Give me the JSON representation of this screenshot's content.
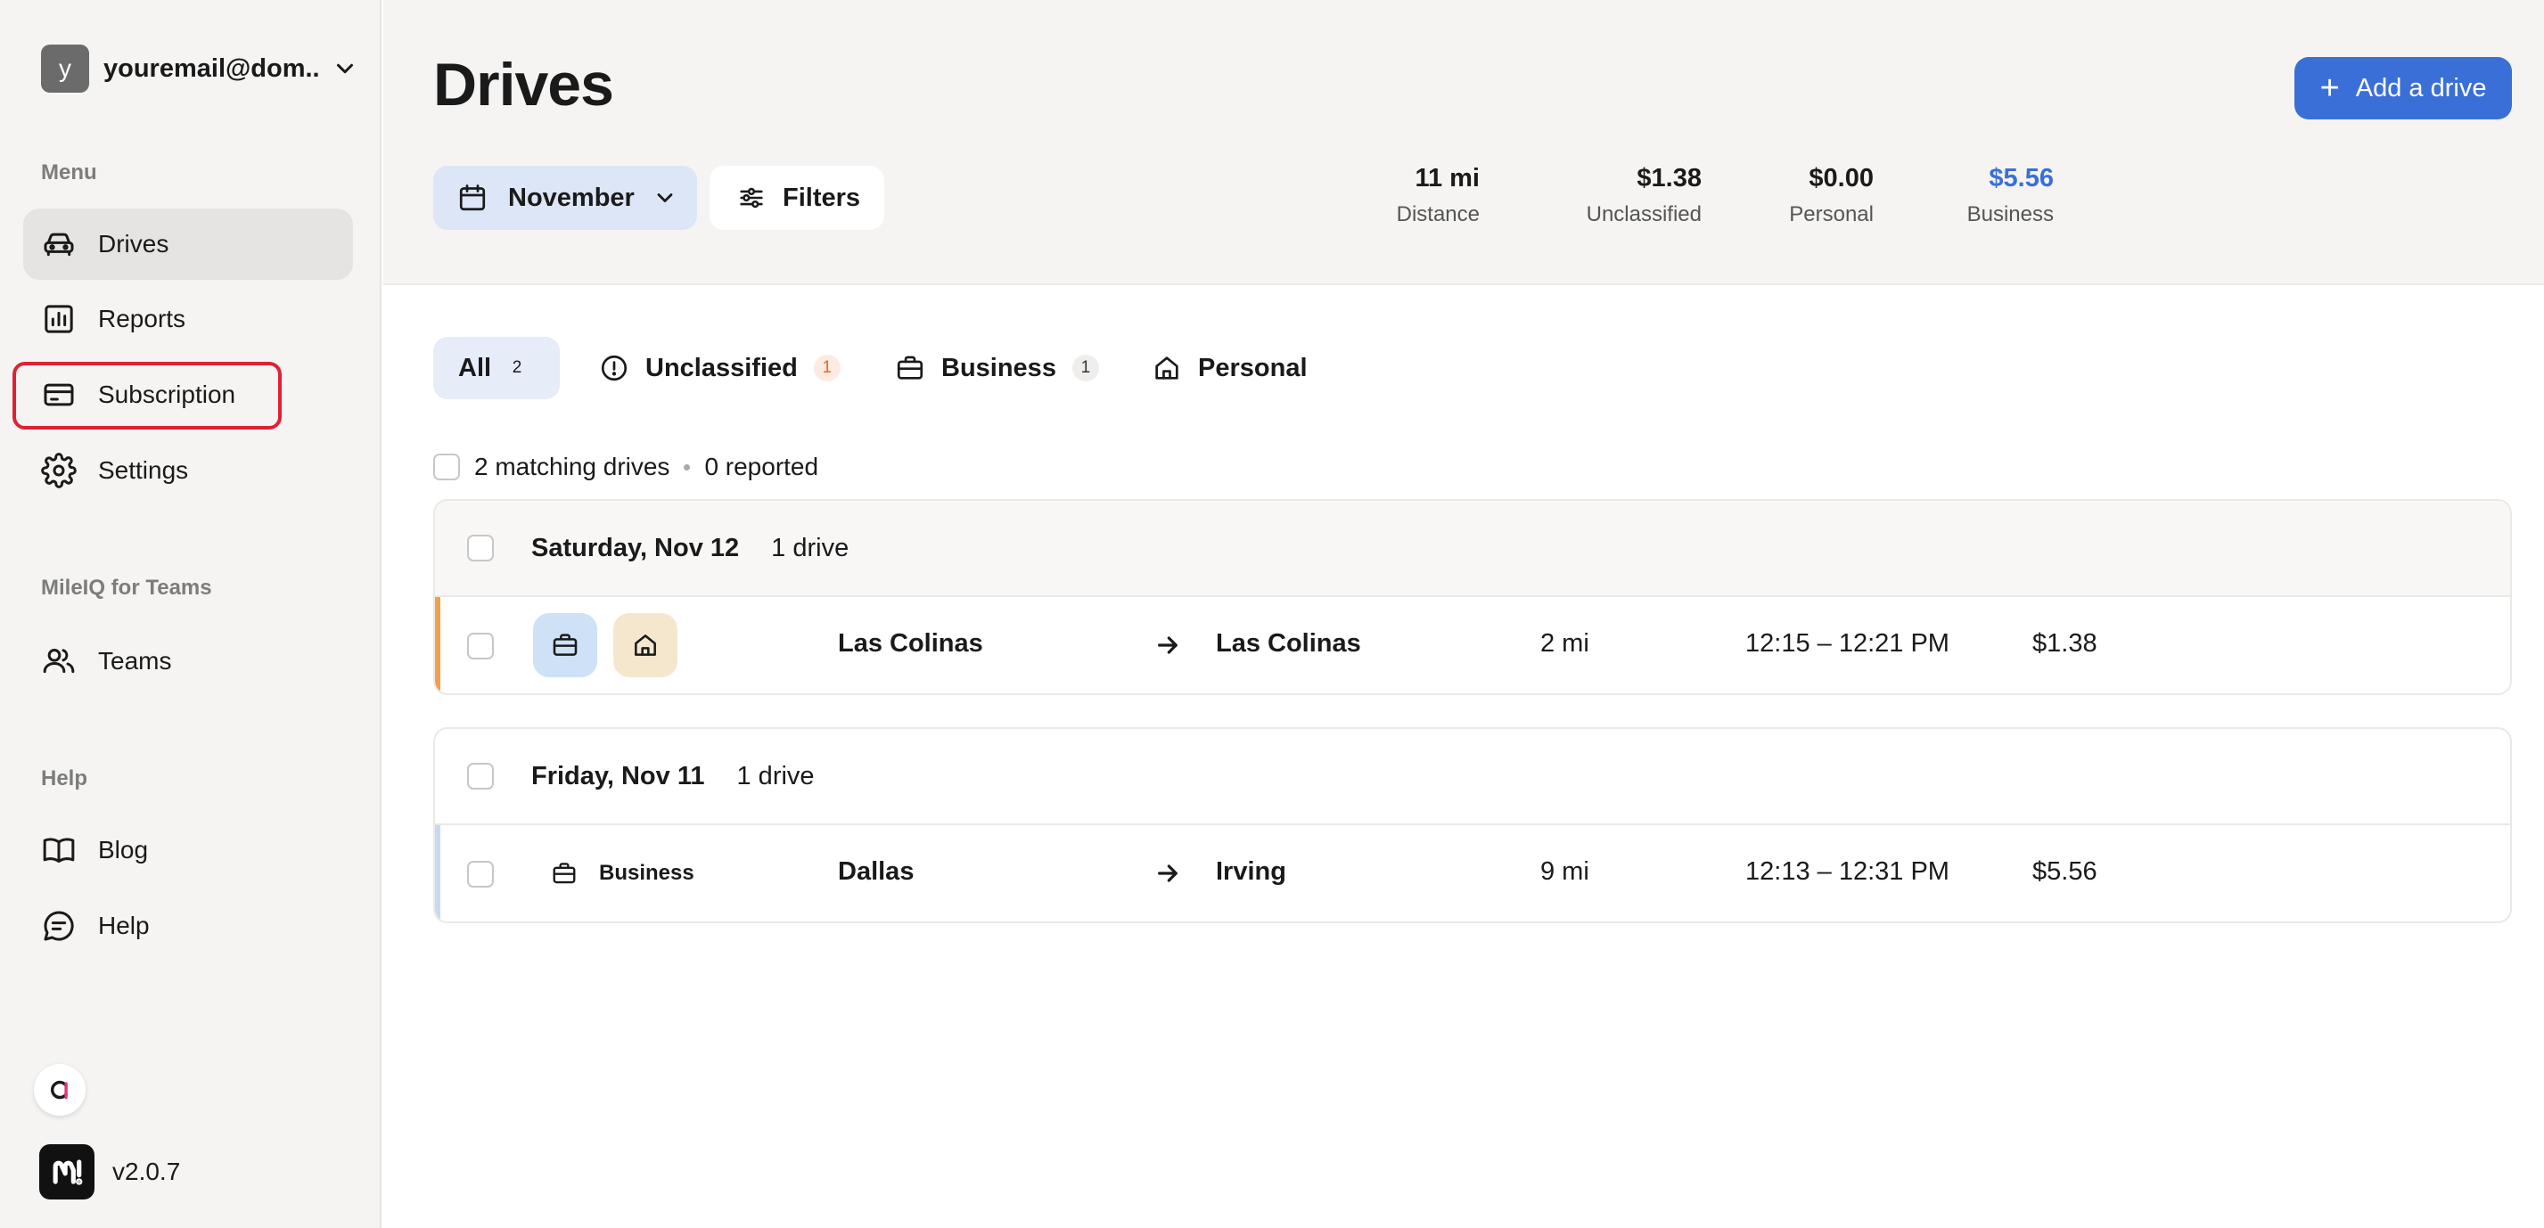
{
  "account": {
    "avatar_letter": "y",
    "email": "youremail@dom..."
  },
  "sidebar": {
    "menu_label": "Menu",
    "items": [
      {
        "label": "Drives",
        "icon": "car-icon",
        "active": true
      },
      {
        "label": "Reports",
        "icon": "bar-chart-icon"
      },
      {
        "label": "Subscription",
        "icon": "credit-card-icon"
      },
      {
        "label": "Settings",
        "icon": "gear-icon"
      }
    ],
    "teams_label": "MileIQ for Teams",
    "teams_items": [
      {
        "label": "Teams",
        "icon": "users-icon"
      }
    ],
    "help_label": "Help",
    "help_items": [
      {
        "label": "Blog",
        "icon": "book-icon"
      },
      {
        "label": "Help",
        "icon": "chat-icon"
      }
    ],
    "version": "v2.0.7"
  },
  "header": {
    "title": "Drives",
    "add_button": "Add a drive",
    "month": "November",
    "filters": "Filters",
    "stats": [
      {
        "value": "11 mi",
        "label": "Distance"
      },
      {
        "value": "$1.38",
        "label": "Unclassified"
      },
      {
        "value": "$0.00",
        "label": "Personal"
      },
      {
        "value": "$5.56",
        "label": "Business"
      }
    ]
  },
  "tabs": [
    {
      "label": "All",
      "count": "2",
      "active": true
    },
    {
      "label": "Unclassified",
      "count": "1"
    },
    {
      "label": "Business",
      "count": "1"
    },
    {
      "label": "Personal"
    }
  ],
  "summary": {
    "matching": "2 matching drives",
    "reported": "0 reported"
  },
  "groups": [
    {
      "date": "Saturday, Nov 12",
      "count": "1 drive",
      "drive": {
        "from": "Las Colinas",
        "to": "Las Colinas",
        "distance": "2 mi",
        "time": "12:15 – 12:21 PM",
        "value": "$1.38",
        "status": "unclassified"
      }
    },
    {
      "date": "Friday, Nov 11",
      "count": "1 drive",
      "drive": {
        "classification": "Business",
        "from": "Dallas",
        "to": "Irving",
        "distance": "9 mi",
        "time": "12:13 – 12:31 PM",
        "value": "$5.56",
        "status": "business"
      }
    }
  ],
  "colors": {
    "accent": "#3a6fd8",
    "unclassified": "#f0a04b",
    "business_stripe": "#c8d9f2",
    "highlight": "#e02134"
  }
}
